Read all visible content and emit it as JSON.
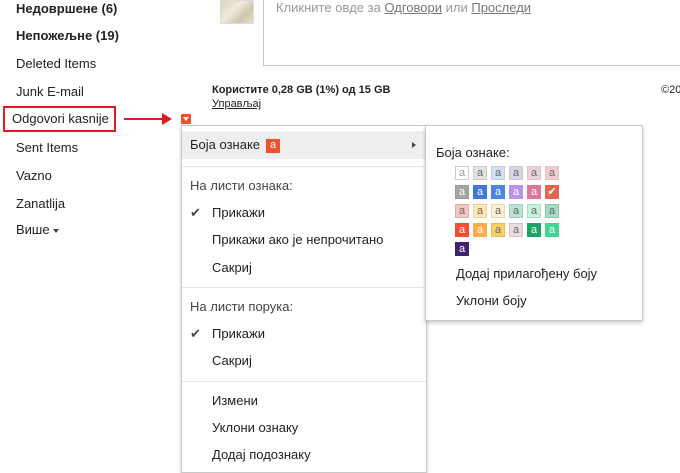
{
  "sidebar": {
    "items": [
      {
        "label": "Недовршене (6)",
        "bold": true
      },
      {
        "label": "Непожељне (19)",
        "bold": true
      },
      {
        "label": "Deleted Items",
        "bold": false
      },
      {
        "label": "Junk E-mail",
        "bold": false
      },
      {
        "label": "Odgovori kasnije",
        "bold": false,
        "highlighted": true
      },
      {
        "label": "Sent Items",
        "bold": false
      },
      {
        "label": "Vazno",
        "bold": false
      },
      {
        "label": "Zanatlija",
        "bold": false
      },
      {
        "label": "Више",
        "bold": false
      }
    ]
  },
  "reply": {
    "prefix": "Кликните овде за ",
    "reply_link": "Одговори",
    "middle": " или ",
    "forward_link": "Проследи"
  },
  "storage": {
    "usage": "Користите 0,28 GB (1%) од 15 GB",
    "manage": "Управљај"
  },
  "footer": {
    "copyright": "©20"
  },
  "menu": {
    "label_color": "Боја ознаке",
    "label_badge": "a",
    "in_label_list": "На листи ознака:",
    "show": "Прикажи",
    "show_if_unread": "Прикажи ако је непрочитано",
    "hide": "Сакриј",
    "in_message_list": "На листи порука:",
    "show2": "Прикажи",
    "hide2": "Сакриј",
    "edit": "Измени",
    "remove_label": "Уклони ознаку",
    "add_sublabel": "Додај подознаку",
    "check_glyph": "✔"
  },
  "submenu": {
    "title": "Боја ознаке:",
    "add_custom": "Додај прилагођену боју",
    "remove_color": "Уклони боју",
    "swatch_glyph": "a",
    "rows": [
      [
        {
          "bg": "#ffffff",
          "fg": "#999999",
          "border": "#cccccc"
        },
        {
          "bg": "#e3e3e3",
          "fg": "#666666",
          "border": "#cccccc"
        },
        {
          "bg": "#cfe2f3",
          "fg": "#666666",
          "border": "#cccccc"
        },
        {
          "bg": "#d9d2e9",
          "fg": "#666666",
          "border": "#cccccc"
        },
        {
          "bg": "#ead1dc",
          "fg": "#666666",
          "border": "#cccccc"
        },
        {
          "bg": "#f4cccc",
          "fg": "#666666",
          "border": "#cccccc"
        }
      ],
      [
        {
          "bg": "#a4a4a4",
          "fg": "#ffffff",
          "border": "#999999"
        },
        {
          "bg": "#3d78d8",
          "fg": "#ffffff",
          "border": "#3d78d8"
        },
        {
          "bg": "#4a86e8",
          "fg": "#ffffff",
          "border": "#4a86e8"
        },
        {
          "bg": "#b694e8",
          "fg": "#ffffff",
          "border": "#b694e8"
        },
        {
          "bg": "#e07798",
          "fg": "#ffffff",
          "border": "#e07798"
        },
        {
          "bg": "#e66550",
          "fg": "#ffffff",
          "border": "#e66550",
          "selected": true
        }
      ],
      [
        {
          "bg": "#f6c5be",
          "fg": "#666666",
          "border": "#e0b0a8"
        },
        {
          "bg": "#fce8b3",
          "fg": "#666666",
          "border": "#e6d39e"
        },
        {
          "bg": "#fef1d1",
          "fg": "#666666",
          "border": "#e6d9b8"
        },
        {
          "bg": "#b9e4d0",
          "fg": "#666666",
          "border": "#a3ceba"
        },
        {
          "bg": "#c6f3de",
          "fg": "#666666",
          "border": "#aedcc6"
        },
        {
          "bg": "#a2dcc1",
          "fg": "#666666",
          "border": "#8ec6ac"
        }
      ],
      [
        {
          "bg": "#fb4c2f",
          "fg": "#ffffff",
          "border": "#fb4c2f"
        },
        {
          "bg": "#ffad47",
          "fg": "#ffffff",
          "border": "#ffad47"
        },
        {
          "bg": "#fad165",
          "fg": "#666666",
          "border": "#e6bd52"
        },
        {
          "bg": "#ebdbde",
          "fg": "#666666",
          "border": "#d4c4c7"
        },
        {
          "bg": "#16a766",
          "fg": "#ffffff",
          "border": "#16a766"
        },
        {
          "bg": "#43d692",
          "fg": "#ffffff",
          "border": "#43d692"
        }
      ],
      [
        {
          "bg": "#41236d",
          "fg": "#ffffff",
          "border": "#41236d"
        }
      ]
    ]
  },
  "colors": {
    "accent_red": "#e11b22",
    "label_orange": "#f0512f"
  }
}
